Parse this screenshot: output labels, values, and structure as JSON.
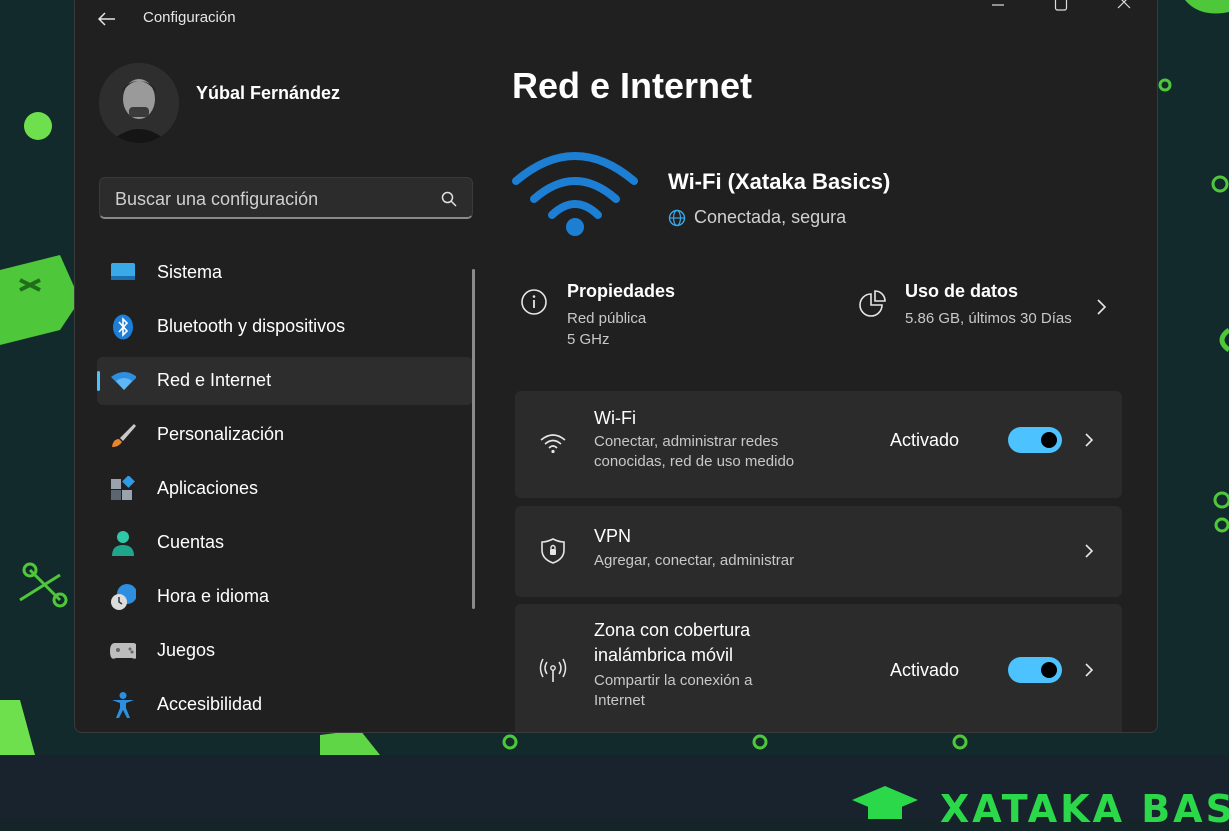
{
  "window": {
    "title": "Configuración"
  },
  "user": {
    "name": "Yúbal Fernández"
  },
  "search": {
    "placeholder": "Buscar una configuración"
  },
  "nav": {
    "items": [
      {
        "label": "Sistema",
        "icon": "monitor-icon"
      },
      {
        "label": "Bluetooth y dispositivos",
        "icon": "bluetooth-icon"
      },
      {
        "label": "Red e Internet",
        "icon": "wifi-icon",
        "active": true
      },
      {
        "label": "Personalización",
        "icon": "brush-icon"
      },
      {
        "label": "Aplicaciones",
        "icon": "apps-icon"
      },
      {
        "label": "Cuentas",
        "icon": "person-icon"
      },
      {
        "label": "Hora e idioma",
        "icon": "clock-globe-icon"
      },
      {
        "label": "Juegos",
        "icon": "gamepad-icon"
      },
      {
        "label": "Accesibilidad",
        "icon": "accessibility-icon"
      }
    ]
  },
  "main": {
    "title": "Red e Internet",
    "connection": {
      "name": "Wi-Fi (Xataka Basics)",
      "status": "Conectada, segura"
    },
    "properties": {
      "title": "Propiedades",
      "line1": "Red pública",
      "line2": "5 GHz"
    },
    "data_usage": {
      "title": "Uso de datos",
      "detail": "5.86 GB, últimos 30 Días"
    },
    "cards": [
      {
        "title": "Wi-Fi",
        "desc": "Conectar, administrar redes conocidas, red de uso medido",
        "state": "Activado",
        "toggle_on": true
      },
      {
        "title": "VPN",
        "desc": "Agregar, conectar, administrar"
      },
      {
        "title": "Zona con cobertura inalámbrica móvil",
        "desc": "Compartir la conexión a Internet",
        "state": "Activado",
        "toggle_on": true
      }
    ]
  },
  "colors": {
    "accent": "#4cc2ff",
    "brand_green": "#2bd84a",
    "wifi_blue": "#1c7fd4"
  },
  "brand": {
    "text": "XATAKA BASIC"
  }
}
